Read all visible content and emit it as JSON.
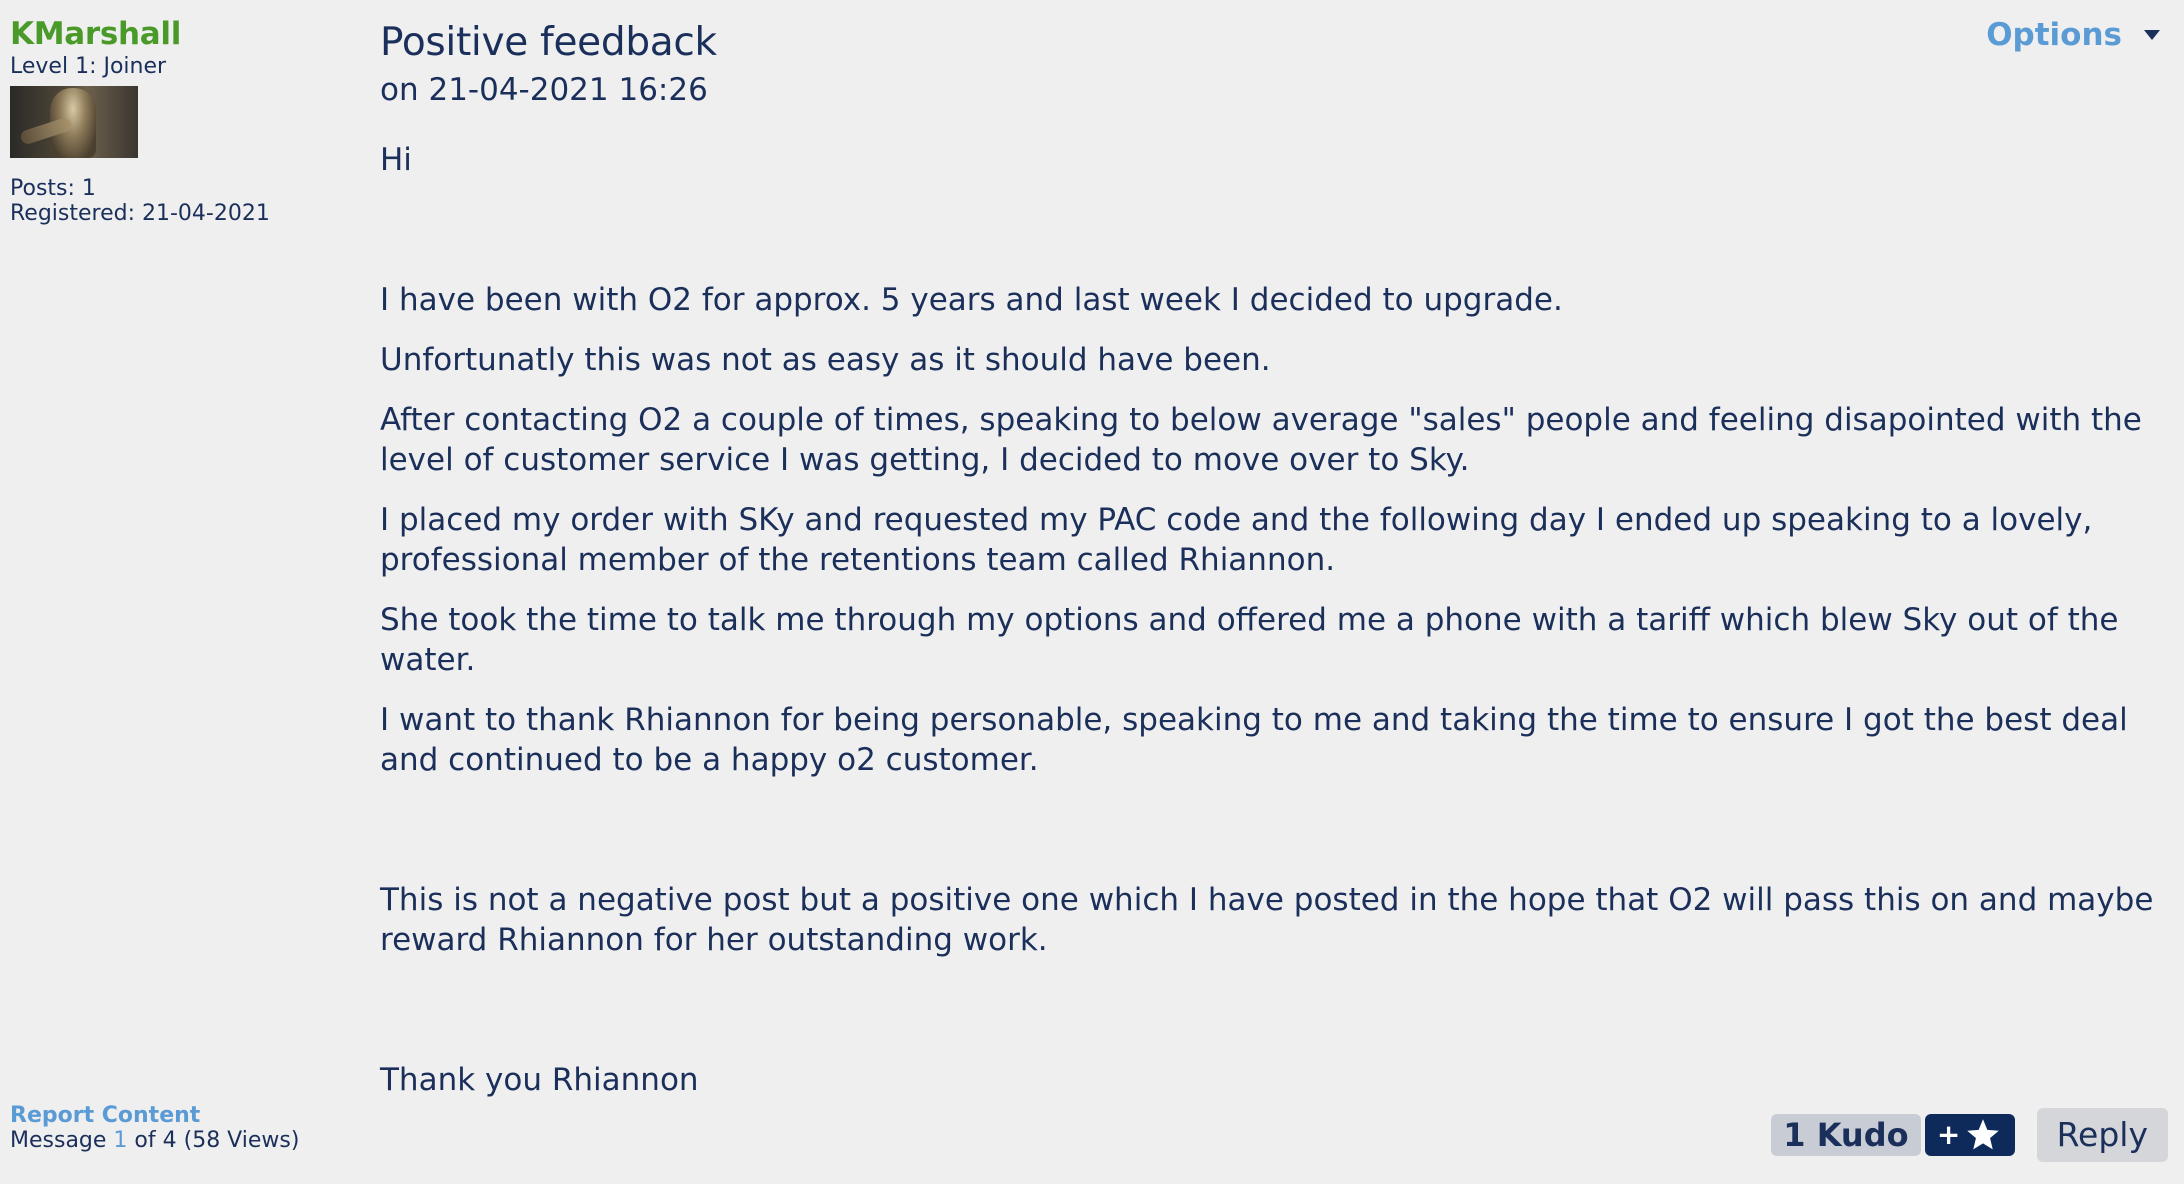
{
  "author": {
    "username": "KMarshall",
    "rank": "Level 1: Joiner",
    "posts": "Posts: 1",
    "registered": "Registered: 21-04-2021"
  },
  "post": {
    "title": "Positive feedback",
    "date": "on 21-04-2021 16:26",
    "options_label": "Options",
    "body": {
      "p1": "Hi",
      "p2": "I have been with O2 for approx. 5 years and last week I decided to upgrade.",
      "p3": "Unfortunatly this was not as easy as it should have been.",
      "p4": "After contacting O2 a couple of times, speaking to below average \"sales\" people and feeling disapointed with the level of customer service I was getting, I decided to move over to Sky.",
      "p5": "I placed my order with SKy and requested my PAC code and the following day I ended up speaking to a lovely, professional member of the retentions team called Rhiannon.",
      "p6": "She took the time to talk me through my options and offered me a phone with a tariff which blew Sky out of the water.",
      "p7": "I want to thank Rhiannon for being personable, speaking to me and taking the time to ensure I got the best deal and continued to be a happy o2 customer.",
      "p8": "This is not a negative post but a positive one which I have posted in the hope that O2 will pass this on and maybe reward Rhiannon for her outstanding work.",
      "p9": "Thank you Rhiannon"
    }
  },
  "footer": {
    "report_label": "Report Content",
    "message_prefix": "Message",
    "message_number": "1",
    "message_suffix": "of 4 (58 Views)",
    "kudo_count": "1 Kudo",
    "kudo_plus": "+",
    "reply_label": "Reply"
  },
  "colors": {
    "username": "#4a9a2a",
    "link": "#5b9bd5",
    "text": "#1b2f5b",
    "kudo_button": "#0d2a5a",
    "background": "#efefef"
  },
  "icons": {
    "options_caret": "caret-down-icon",
    "kudo_star": "star-icon"
  }
}
